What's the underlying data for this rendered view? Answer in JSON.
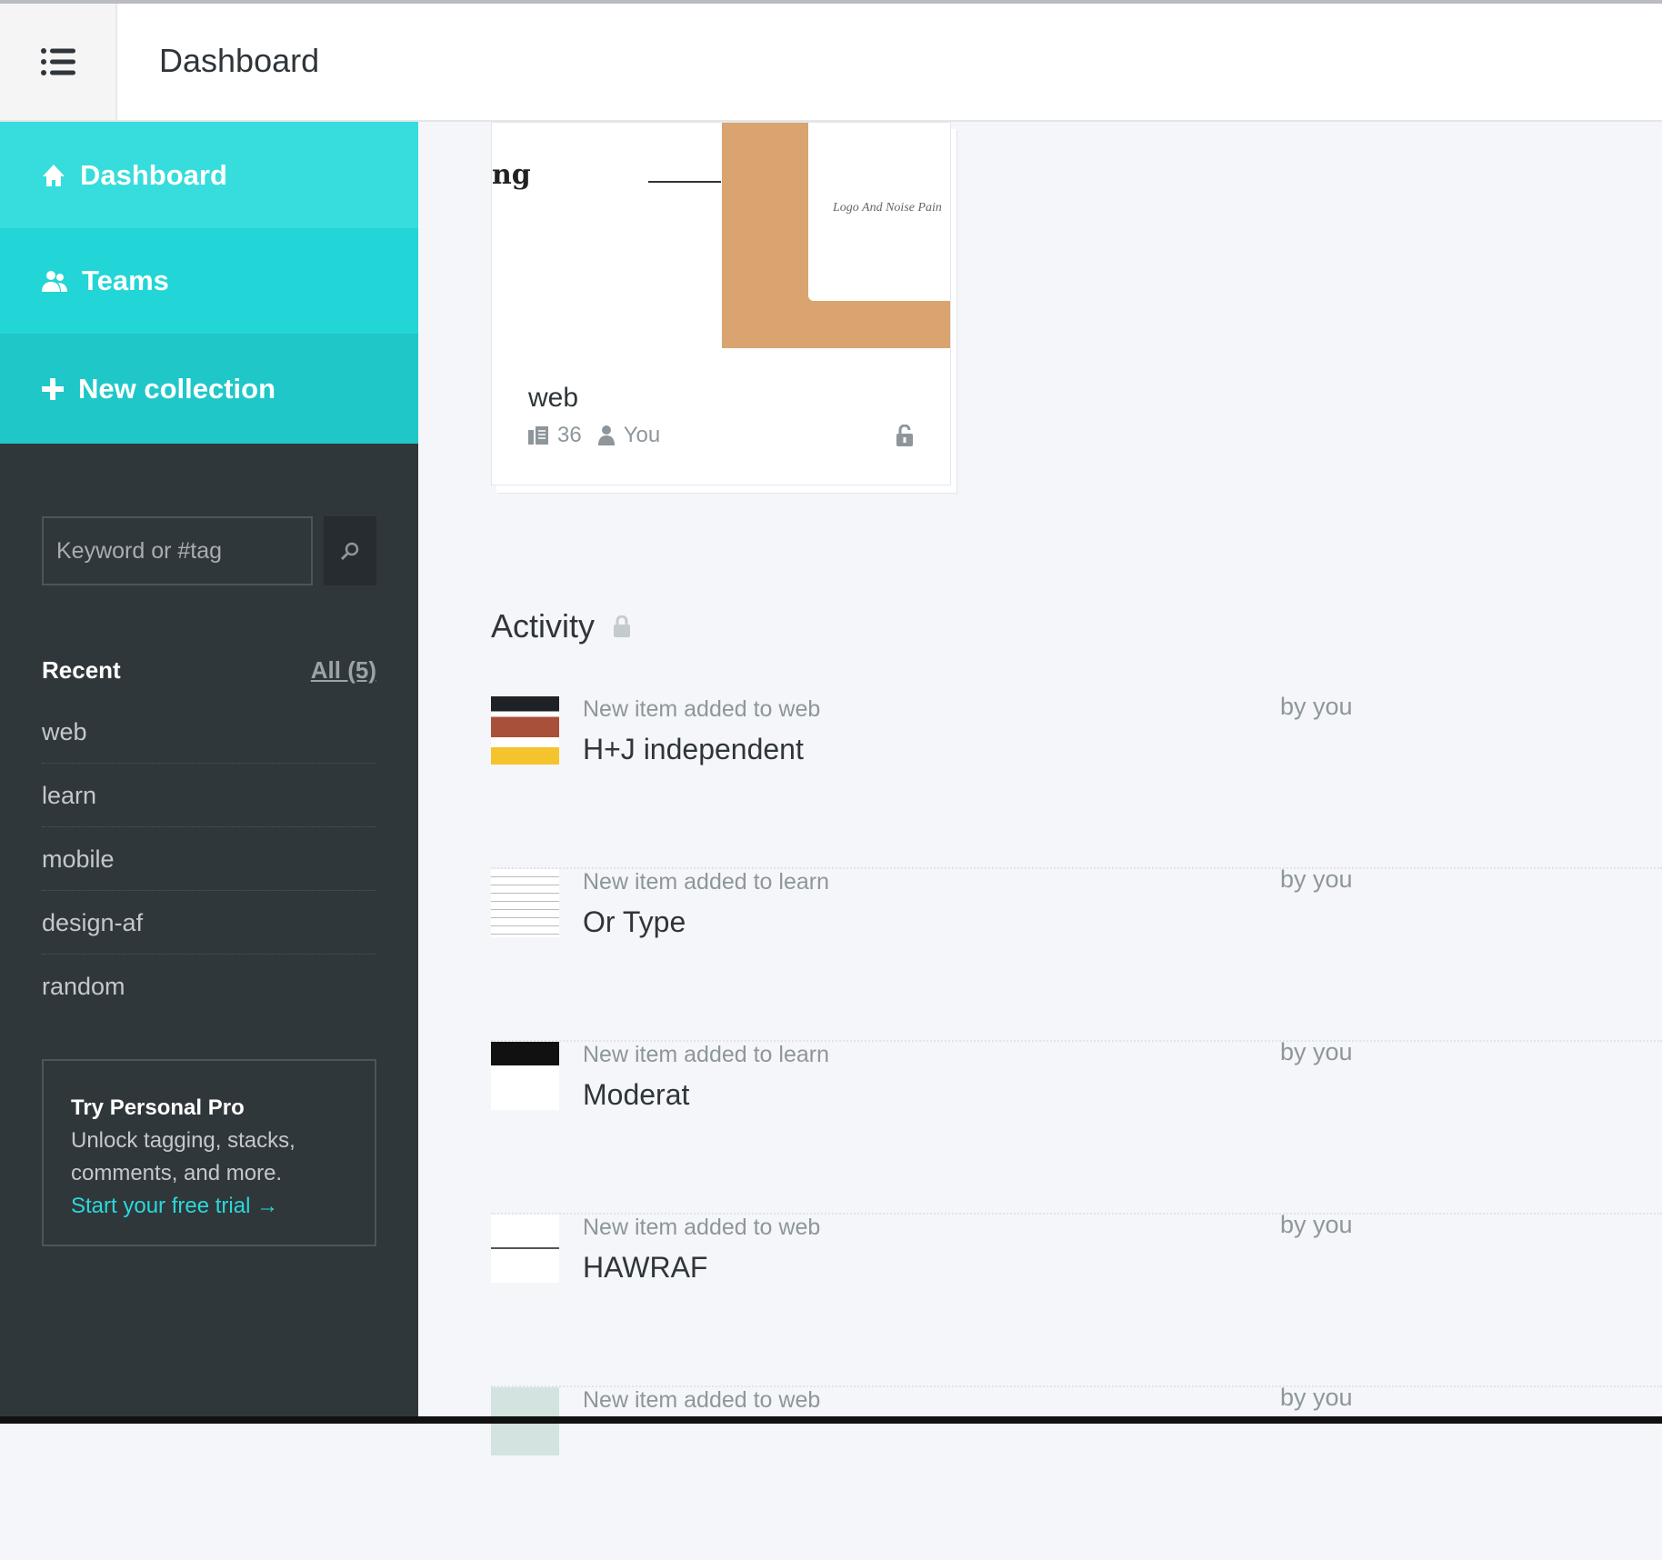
{
  "header": {
    "title": "Dashboard"
  },
  "nav": [
    {
      "label": "Dashboard"
    },
    {
      "label": "Teams"
    },
    {
      "label": "New collection"
    }
  ],
  "search": {
    "placeholder": "Keyword or #tag"
  },
  "recent": {
    "heading": "Recent",
    "all_label": "All (5)",
    "items": [
      "web",
      "learn",
      "mobile",
      "design-af",
      "random"
    ]
  },
  "promo": {
    "title": "Try Personal Pro",
    "body": "Unlock tagging, stacks, comments, and more.",
    "link": "Start your free trial →"
  },
  "collection": {
    "name": "web",
    "count": "36",
    "owner": "You",
    "preview_text": "Logo And Noise Pain"
  },
  "activity": {
    "title": "Activity",
    "items": [
      {
        "subtitle": "New item added to web",
        "name": "H+J independent",
        "by": "by you"
      },
      {
        "subtitle": "New item added to learn",
        "name": "Or Type",
        "by": "by you"
      },
      {
        "subtitle": "New item added to learn",
        "name": "Moderat",
        "by": "by you"
      },
      {
        "subtitle": "New item added to web",
        "name": "HAWRAF",
        "by": "by you"
      },
      {
        "subtitle": "New item added to web",
        "name": "",
        "by": "by you"
      }
    ]
  },
  "colors": {
    "accent": "#22d5d7",
    "sidebar": "#30373b"
  }
}
